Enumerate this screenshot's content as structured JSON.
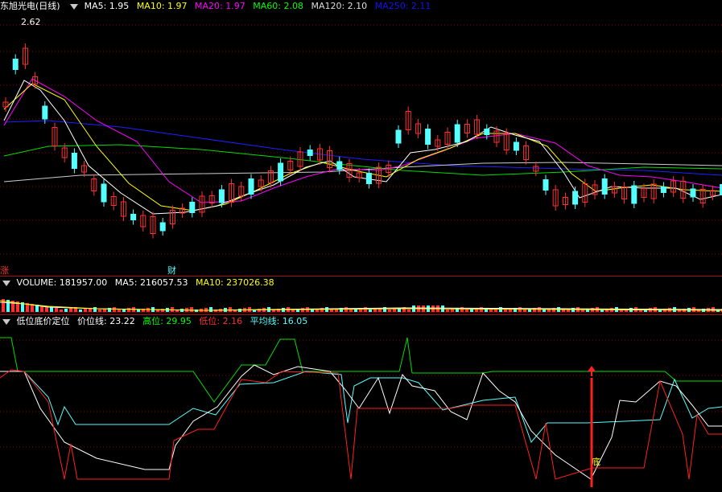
{
  "price_panel": {
    "stock_name": "东旭光电",
    "period": "(日线)",
    "ma_labels": [
      {
        "label": "MA5: 1.95",
        "color": "#ffffff"
      },
      {
        "label": "MA10: 1.97",
        "color": "#ffff00"
      },
      {
        "label": "MA20: 1.97",
        "color": "#ff00ff"
      },
      {
        "label": "MA60: 2.08",
        "color": "#00ff00"
      },
      {
        "label": "MA120: 2.10",
        "color": "#dddddd"
      },
      {
        "label": "MA250: 2.11",
        "color": "#0000ff"
      }
    ],
    "high_mark": "2.62",
    "markers": {
      "zhang": "涨",
      "cai": "财"
    }
  },
  "volume_panel": {
    "volume_label": "VOLUME: 181957.00",
    "ma5_label": "MA5: 216057.53",
    "ma10_label": "MA10: 237026.38"
  },
  "indicator_panel": {
    "name": "低位底价定位",
    "price_line": "价位线: 23.22",
    "high": "高位: 29.95",
    "low": "低位: 2.16",
    "avg": "平均线: 16.05",
    "signal_label": "底"
  },
  "colors": {
    "up": "#ff3030",
    "down": "#54ffff",
    "grid": "#8b0000"
  }
}
